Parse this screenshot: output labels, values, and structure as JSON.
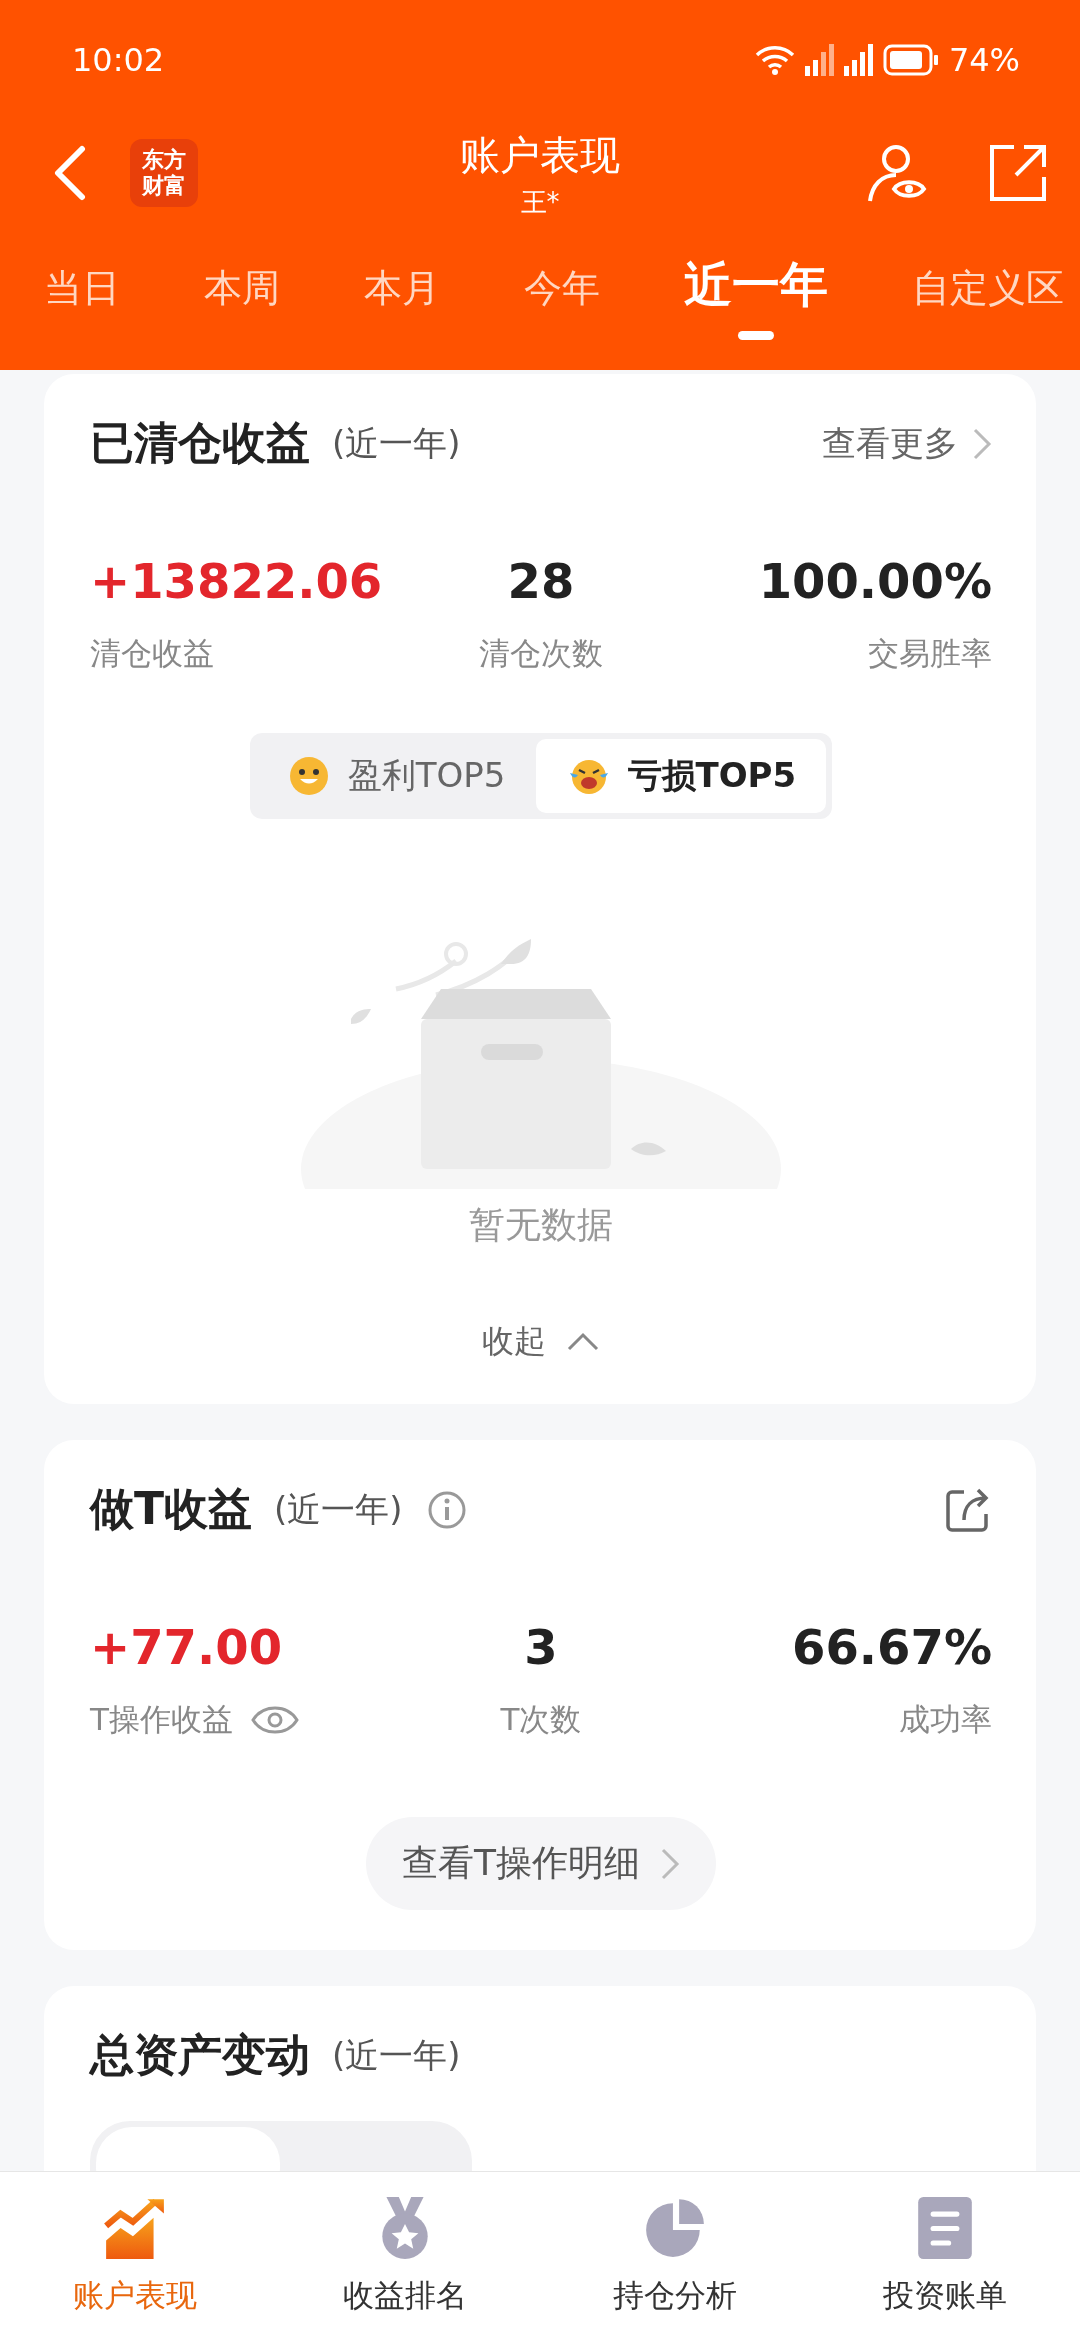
{
  "status_bar": {
    "time": "10:02",
    "battery": "74%"
  },
  "header": {
    "title": "账户表现",
    "subtitle": "王*",
    "logo": [
      "东方",
      "财富"
    ]
  },
  "period_tabs": [
    {
      "label": "当日",
      "selected": false
    },
    {
      "label": "本周",
      "selected": false
    },
    {
      "label": "本月",
      "selected": false
    },
    {
      "label": "今年",
      "selected": false
    },
    {
      "label": "近一年",
      "selected": true
    },
    {
      "label": "自定义区",
      "selected": false
    }
  ],
  "cleared_card": {
    "title": "已清仓收益",
    "period": "(近一年)",
    "more_link": "查看更多",
    "stats": [
      {
        "value": "+13822.06",
        "label": "清仓收益",
        "gain": true
      },
      {
        "value": "28",
        "label": "清仓次数",
        "gain": false
      },
      {
        "value": "100.00%",
        "label": "交易胜率",
        "gain": false
      }
    ],
    "segments": [
      {
        "label": "盈利TOP5",
        "kind": "profit",
        "selected": false
      },
      {
        "label": "亏损TOP5",
        "kind": "loss",
        "selected": true
      }
    ],
    "empty_text": "暂无数据",
    "collapse": "收起"
  },
  "t_card": {
    "title": "做T收益",
    "period": "(近一年)",
    "stats": [
      {
        "value": "+77.00",
        "label": "T操作收益",
        "gain": true,
        "eye": true
      },
      {
        "value": "3",
        "label": "T次数",
        "gain": false,
        "eye": false
      },
      {
        "value": "66.67%",
        "label": "成功率",
        "gain": false,
        "eye": false
      }
    ],
    "detail_button": "查看T操作明细"
  },
  "asset_card": {
    "title": "总资产变动",
    "period": "(近一年)"
  },
  "bottom_nav": [
    {
      "label": "账户表现",
      "kind": "chart",
      "selected": true
    },
    {
      "label": "收益排名",
      "kind": "medal",
      "selected": false
    },
    {
      "label": "持仓分析",
      "kind": "pie",
      "selected": false
    },
    {
      "label": "投资账单",
      "kind": "bill",
      "selected": false
    }
  ]
}
